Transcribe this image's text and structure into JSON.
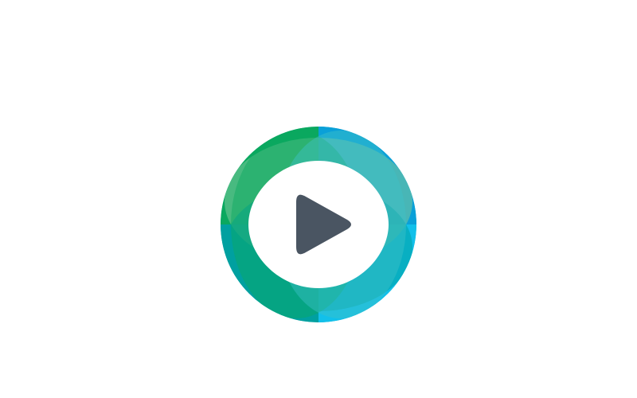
{
  "logo": {
    "icon": "play-icon",
    "colors": {
      "green": "#0aa85f",
      "teal": "#00a0a0",
      "blue": "#0aa0d8",
      "cyan": "#12c0ea",
      "light_green": "#7cc89a",
      "light_teal": "#3fc2c8",
      "play": "#4a5562",
      "background": "#ffffff"
    }
  }
}
